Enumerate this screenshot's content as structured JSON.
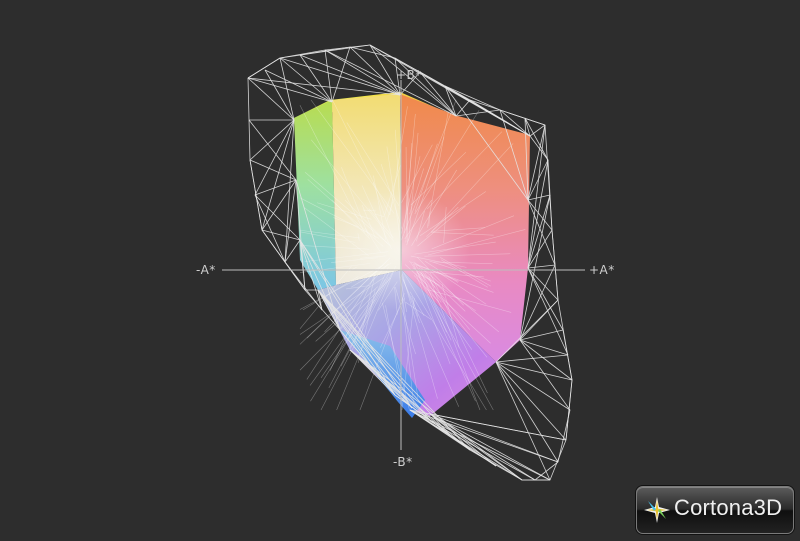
{
  "viewer": {
    "brand_label": "Cortona3D",
    "background_color": "#2d2d2d",
    "wireframe_color": "#e6e6e6"
  },
  "axes": {
    "minus_a": "-A*",
    "plus_a": "+A*",
    "minus_b": "-B*",
    "plus_b": "+B*"
  },
  "icons": {
    "brand_logo": "cortona-star-icon"
  }
}
